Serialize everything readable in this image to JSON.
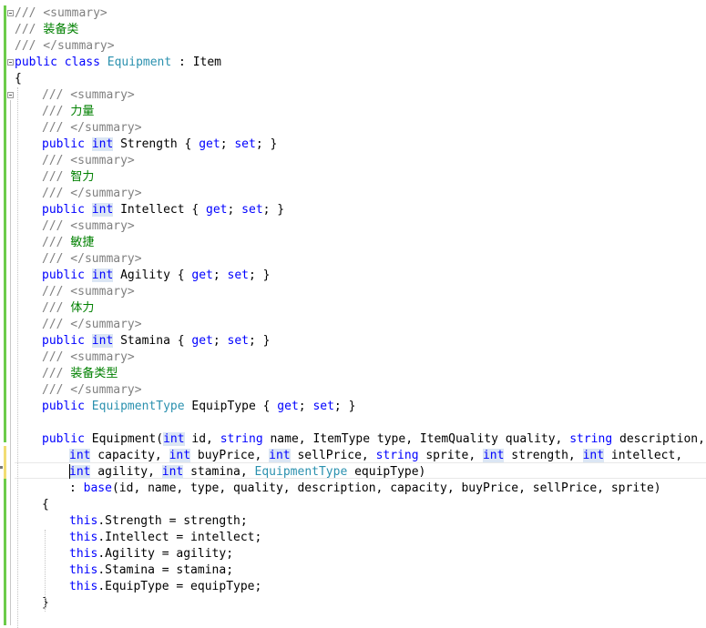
{
  "editor": {
    "language": "C#",
    "lines": [
      {
        "indent": 0,
        "tokens": [
          {
            "t": "/// ",
            "s": "g"
          },
          {
            "t": "<summary>",
            "s": "g"
          }
        ]
      },
      {
        "indent": 0,
        "tokens": [
          {
            "t": "/// ",
            "s": "g"
          },
          {
            "t": "装备类",
            "s": "c"
          }
        ]
      },
      {
        "indent": 0,
        "tokens": [
          {
            "t": "/// </summary>",
            "s": "g"
          }
        ]
      },
      {
        "indent": 0,
        "tokens": [
          {
            "t": "public",
            "s": "k"
          },
          {
            "t": " ",
            "s": ""
          },
          {
            "t": "class",
            "s": "k"
          },
          {
            "t": " ",
            "s": ""
          },
          {
            "t": "Equipment",
            "s": "t"
          },
          {
            "t": " : Item",
            "s": ""
          }
        ]
      },
      {
        "indent": 0,
        "tokens": [
          {
            "t": "{",
            "s": ""
          }
        ]
      },
      {
        "indent": 1,
        "tokens": [
          {
            "t": "/// <summary>",
            "s": "g"
          }
        ]
      },
      {
        "indent": 1,
        "tokens": [
          {
            "t": "/// ",
            "s": "g"
          },
          {
            "t": "力量",
            "s": "c"
          }
        ]
      },
      {
        "indent": 1,
        "tokens": [
          {
            "t": "/// </summary>",
            "s": "g"
          }
        ]
      },
      {
        "indent": 1,
        "tokens": [
          {
            "t": "public",
            "s": "k"
          },
          {
            "t": " ",
            "s": ""
          },
          {
            "t": "int",
            "s": "k hl"
          },
          {
            "t": " Strength { ",
            "s": ""
          },
          {
            "t": "get",
            "s": "k"
          },
          {
            "t": "; ",
            "s": ""
          },
          {
            "t": "set",
            "s": "k"
          },
          {
            "t": "; }",
            "s": ""
          }
        ]
      },
      {
        "indent": 1,
        "tokens": [
          {
            "t": "/// <summary>",
            "s": "g"
          }
        ]
      },
      {
        "indent": 1,
        "tokens": [
          {
            "t": "/// ",
            "s": "g"
          },
          {
            "t": "智力",
            "s": "c"
          }
        ]
      },
      {
        "indent": 1,
        "tokens": [
          {
            "t": "/// </summary>",
            "s": "g"
          }
        ]
      },
      {
        "indent": 1,
        "tokens": [
          {
            "t": "public",
            "s": "k"
          },
          {
            "t": " ",
            "s": ""
          },
          {
            "t": "int",
            "s": "k hl"
          },
          {
            "t": " Intellect { ",
            "s": ""
          },
          {
            "t": "get",
            "s": "k"
          },
          {
            "t": "; ",
            "s": ""
          },
          {
            "t": "set",
            "s": "k"
          },
          {
            "t": "; }",
            "s": ""
          }
        ]
      },
      {
        "indent": 1,
        "tokens": [
          {
            "t": "/// <summary>",
            "s": "g"
          }
        ]
      },
      {
        "indent": 1,
        "tokens": [
          {
            "t": "/// ",
            "s": "g"
          },
          {
            "t": "敏捷",
            "s": "c"
          }
        ]
      },
      {
        "indent": 1,
        "tokens": [
          {
            "t": "/// </summary>",
            "s": "g"
          }
        ]
      },
      {
        "indent": 1,
        "tokens": [
          {
            "t": "public",
            "s": "k"
          },
          {
            "t": " ",
            "s": ""
          },
          {
            "t": "int",
            "s": "k hl"
          },
          {
            "t": " Agility { ",
            "s": ""
          },
          {
            "t": "get",
            "s": "k"
          },
          {
            "t": "; ",
            "s": ""
          },
          {
            "t": "set",
            "s": "k"
          },
          {
            "t": "; }",
            "s": ""
          }
        ]
      },
      {
        "indent": 1,
        "tokens": [
          {
            "t": "/// <summary>",
            "s": "g"
          }
        ]
      },
      {
        "indent": 1,
        "tokens": [
          {
            "t": "/// ",
            "s": "g"
          },
          {
            "t": "体力",
            "s": "c"
          }
        ]
      },
      {
        "indent": 1,
        "tokens": [
          {
            "t": "/// </summary>",
            "s": "g"
          }
        ]
      },
      {
        "indent": 1,
        "tokens": [
          {
            "t": "public",
            "s": "k"
          },
          {
            "t": " ",
            "s": ""
          },
          {
            "t": "int",
            "s": "k hl"
          },
          {
            "t": " Stamina { ",
            "s": ""
          },
          {
            "t": "get",
            "s": "k"
          },
          {
            "t": "; ",
            "s": ""
          },
          {
            "t": "set",
            "s": "k"
          },
          {
            "t": "; }",
            "s": ""
          }
        ]
      },
      {
        "indent": 1,
        "tokens": [
          {
            "t": "/// <summary>",
            "s": "g"
          }
        ]
      },
      {
        "indent": 1,
        "tokens": [
          {
            "t": "/// ",
            "s": "g"
          },
          {
            "t": "装备类型",
            "s": "c"
          }
        ]
      },
      {
        "indent": 1,
        "tokens": [
          {
            "t": "/// </summary>",
            "s": "g"
          }
        ]
      },
      {
        "indent": 1,
        "tokens": [
          {
            "t": "public",
            "s": "k"
          },
          {
            "t": " ",
            "s": ""
          },
          {
            "t": "EquipmentType",
            "s": "t"
          },
          {
            "t": " EquipType { ",
            "s": ""
          },
          {
            "t": "get",
            "s": "k"
          },
          {
            "t": "; ",
            "s": ""
          },
          {
            "t": "set",
            "s": "k"
          },
          {
            "t": "; }",
            "s": ""
          }
        ]
      },
      {
        "indent": 1,
        "tokens": []
      },
      {
        "indent": 1,
        "tokens": [
          {
            "t": "public",
            "s": "k"
          },
          {
            "t": " Equipment(",
            "s": ""
          },
          {
            "t": "int",
            "s": "k hl"
          },
          {
            "t": " id, ",
            "s": ""
          },
          {
            "t": "string",
            "s": "k"
          },
          {
            "t": " name, ItemType type, ItemQuality quality, ",
            "s": ""
          },
          {
            "t": "string",
            "s": "k"
          },
          {
            "t": " description,",
            "s": ""
          }
        ]
      },
      {
        "indent": 2,
        "tokens": [
          {
            "t": "int",
            "s": "k hl"
          },
          {
            "t": " capacity, ",
            "s": ""
          },
          {
            "t": "int",
            "s": "k hl"
          },
          {
            "t": " buyPrice, ",
            "s": ""
          },
          {
            "t": "int",
            "s": "k hl"
          },
          {
            "t": " sellPrice, ",
            "s": ""
          },
          {
            "t": "string",
            "s": "k"
          },
          {
            "t": " sprite, ",
            "s": ""
          },
          {
            "t": "int",
            "s": "k hl"
          },
          {
            "t": " strength, ",
            "s": ""
          },
          {
            "t": "int",
            "s": "k hl"
          },
          {
            "t": " intellect,",
            "s": ""
          }
        ]
      },
      {
        "indent": 2,
        "tokens": [
          {
            "t": "int",
            "s": "k hl"
          },
          {
            "t": " agility, ",
            "s": ""
          },
          {
            "t": "int",
            "s": "k hl"
          },
          {
            "t": " stamina, ",
            "s": ""
          },
          {
            "t": "EquipmentType",
            "s": "t"
          },
          {
            "t": " equipType)",
            "s": ""
          }
        ]
      },
      {
        "indent": 2,
        "tokens": [
          {
            "t": ": ",
            "s": ""
          },
          {
            "t": "base",
            "s": "k"
          },
          {
            "t": "(id, name, type, quality, description, capacity, buyPrice, sellPrice, sprite)",
            "s": ""
          }
        ]
      },
      {
        "indent": 1,
        "tokens": [
          {
            "t": "{",
            "s": ""
          }
        ]
      },
      {
        "indent": 2,
        "tokens": [
          {
            "t": "this",
            "s": "k"
          },
          {
            "t": ".Strength = strength;",
            "s": ""
          }
        ]
      },
      {
        "indent": 2,
        "tokens": [
          {
            "t": "this",
            "s": "k"
          },
          {
            "t": ".Intellect = intellect;",
            "s": ""
          }
        ]
      },
      {
        "indent": 2,
        "tokens": [
          {
            "t": "this",
            "s": "k"
          },
          {
            "t": ".Agility = agility;",
            "s": ""
          }
        ]
      },
      {
        "indent": 2,
        "tokens": [
          {
            "t": "this",
            "s": "k"
          },
          {
            "t": ".Stamina = stamina;",
            "s": ""
          }
        ]
      },
      {
        "indent": 2,
        "tokens": [
          {
            "t": "this",
            "s": "k"
          },
          {
            "t": ".EquipType = equipType;",
            "s": ""
          }
        ]
      },
      {
        "indent": 1,
        "tokens": [
          {
            "t": "}",
            "s": ""
          }
        ]
      }
    ]
  },
  "colors": {
    "keyword": "#0000ff",
    "type": "#2b91af",
    "comment": "#008000",
    "doc_tag": "#808080",
    "highlight": "#dbe6f4",
    "change_bar": "#6ccb4a"
  }
}
